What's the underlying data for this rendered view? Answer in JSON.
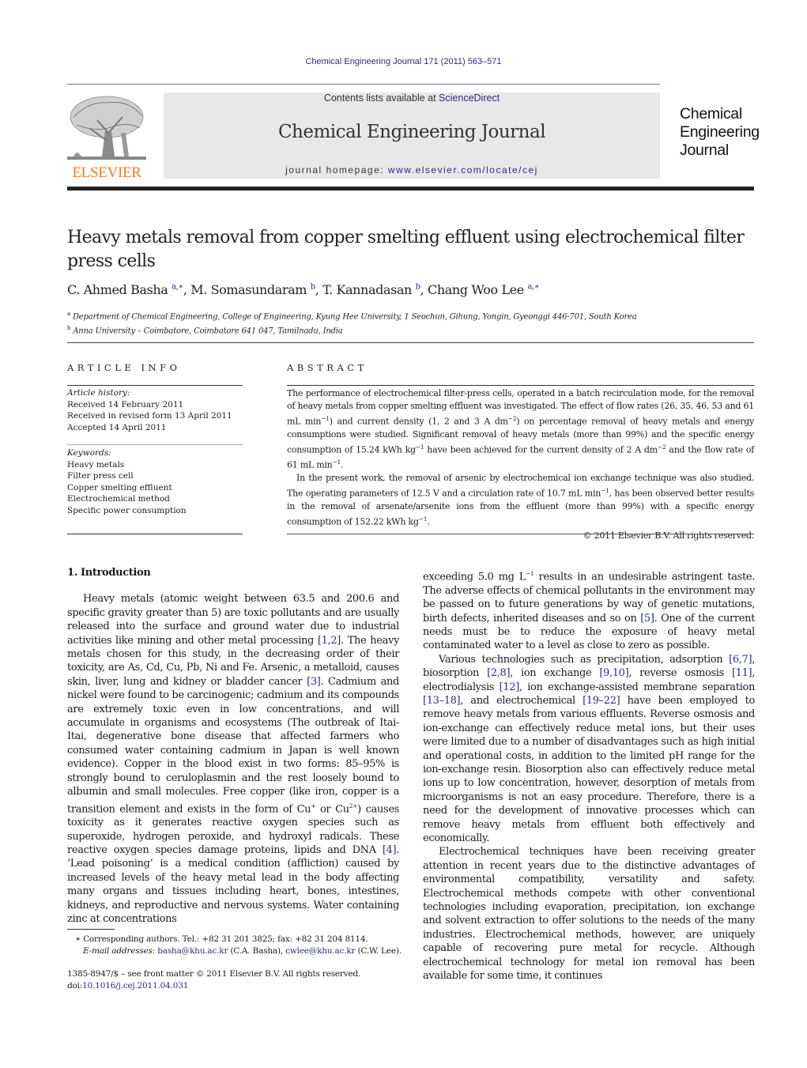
{
  "header": {
    "citation": "Chemical Engineering Journal 171 (2011) 563–571",
    "publisher_logo_word": "ELSEVIER",
    "contents_prefix": "Contents lists available at ",
    "contents_link": "ScienceDirect",
    "journal_title": "Chemical Engineering Journal",
    "homepage_prefix": "journal homepage: ",
    "homepage_link": "www.elsevier.com/locate/cej",
    "cover_title_lines": [
      "Chemical",
      "Engineering",
      "Journal"
    ],
    "colors": {
      "elsevier_orange": "#f07f1a",
      "link_blue": "#2a2a8c",
      "banner_gray": "#e8e8e8"
    }
  },
  "article": {
    "title": "Heavy metals removal from copper smelting effluent using electrochemical filter press cells",
    "authors": [
      {
        "name": "C. Ahmed Basha",
        "sup": "a,∗"
      },
      {
        "name": "M. Somasundaram",
        "sup": "b"
      },
      {
        "name": "T. Kannadasan",
        "sup": "b"
      },
      {
        "name": "Chang Woo Lee",
        "sup": "a,∗"
      }
    ],
    "affiliations": [
      {
        "mark": "a",
        "text": "Department of Chemical Engineering, College of Engineering, Kyung Hee University, 1 Seochun, Gihung, Yongin, Gyeonggi 446-701, South Korea"
      },
      {
        "mark": "b",
        "text": "Anna University – Coimbatore, Coimbatore 641 047, Tamilnadu, India"
      }
    ]
  },
  "article_info": {
    "heading": "ARTICLE INFO",
    "history_label": "Article history:",
    "history": [
      "Received 14 February 2011",
      "Received in revised form 13 April 2011",
      "Accepted 14 April 2011"
    ],
    "keywords_label": "Keywords:",
    "keywords": [
      "Heavy metals",
      "Filter press cell",
      "Copper smelting effluent",
      "Electrochemical method",
      "Specific power consumption"
    ]
  },
  "abstract": {
    "heading": "ABSTRACT",
    "p1": [
      "The performance of electrochemical filter-press cells, operated in a batch recirculation mode, for the removal of heavy metals from copper smelting effluent was investigated. The effect of flow rates (26, 35, 46, 53 and 61 mL min",
      "−1",
      ") and current density (1, 2 and 3 A dm",
      "−2",
      ") on percentage removal of heavy metals and energy consumptions were studied. Significant removal of heavy metals (more than 99%) and the specific energy consumption of 15.24 kWh kg",
      "−1",
      " have been achieved for the current density of 2 A dm",
      "−2",
      " and the flow rate of 61 mL min",
      "−1",
      "."
    ],
    "p2": [
      "In the present work, the removal of arsenic by electrochemical ion exchange technique was also studied. The operating parameters of 12.5 V and a circulation rate of 10.7 mL min",
      "−1",
      ", has been observed better results in the removal of arsenate/arsenite ions from the effluent (more than 99%) with a specific energy consumption of 152.22 kWh kg",
      "−1",
      "."
    ],
    "copyright": "© 2011 Elsevier B.V. All rights reserved."
  },
  "body": {
    "section_heading": "1.  Introduction",
    "left_p1": {
      "t1": "Heavy metals (atomic weight between 63.5 and 200.6 and specific gravity greater than 5) are toxic pollutants and are usually released into the surface and ground water due to industrial activities like mining and other metal processing ",
      "r1": "[1,2]",
      "t2": ". The heavy metals chosen for this study, in the decreasing order of their toxicity, are As, Cd, Cu, Pb, Ni and Fe. Arsenic, a metalloid, causes skin, liver, lung and kidney or bladder cancer ",
      "r2": "[3]",
      "t3": ". Cadmium and nickel were found to be carcinogenic; cadmium and its compounds are extremely toxic even in low concentrations, and will accumulate in organisms and ecosystems (The outbreak of Itai-Itai, degenerative bone disease that affected farmers who consumed water containing cadmium in Japan is well known evidence). Copper in the blood exist in two forms: 85–95% is strongly bound to ceruloplasmin and the rest loosely bound to albumin and small molecules. Free copper (like iron, copper is a transition element and exists in the form of Cu",
      "s1": "+",
      "t4": " or Cu",
      "s2": "2+",
      "t5": ") causes toxicity as it generates reactive oxygen species such as superoxide, hydrogen peroxide, and hydroxyl radicals. These reactive oxygen species damage proteins, lipids and DNA ",
      "r3": "[4]",
      "t6": ". ‘Lead poisoning’ is a medical condition (affliction) caused by increased levels of the heavy metal lead in the body affecting many organs and tissues including heart, bones, intestines, kidneys, and reproductive and nervous systems. Water containing zinc at concentrations"
    },
    "right_p1": {
      "t1": "exceeding 5.0 mg L",
      "s1": "−1",
      "t2": " results in an undesirable astringent taste. The adverse effects of chemical pollutants in the environment may be passed on to future generations by way of genetic mutations, birth defects, inherited diseases and so on ",
      "r1": "[5]",
      "t3": ". One of the current needs must be to reduce the exposure of heavy metal contaminated water to a level as close to zero as possible."
    },
    "right_p2": {
      "t1": "Various technologies such as precipitation, adsorption ",
      "r1": "[6,7]",
      "t2": ", biosorption ",
      "r2": "[2,8]",
      "t3": ", ion exchange ",
      "r3": "[9,10]",
      "t4": ", reverse osmosis ",
      "r4": "[11]",
      "t5": ", electrodialysis ",
      "r5": "[12]",
      "t6": ", ion exchange-assisted membrane separation ",
      "r6": "[13–18]",
      "t7": ", and electrochemical ",
      "r7": "[19–22]",
      "t8": " have been employed to remove heavy metals from various effluents. Reverse osmosis and ion-exchange can effectively reduce metal ions, but their uses were limited due to a number of disadvantages such as high initial and operational costs, in addition to the limited pH range for the ion-exchange resin. Biosorption also can effectively reduce metal ions up to low concentration, however, desorption of metals from microorganisms is not an easy procedure. Therefore, there is a need for the development of innovative processes which can remove heavy metals from effluent both effectively and economically."
    },
    "right_p3": "Electrochemical techniques have been receiving greater attention in recent years due to the distinctive advantages of environmental compatibility, versatility and safety. Electrochemical methods compete with other conventional technologies including evaporation, precipitation, ion exchange and solvent extraction to offer solutions to the needs of the many industries. Electrochemical methods, however, are uniquely capable of recovering pure metal for recycle. Although electrochemical technology for metal ion removal has been available for some time, it continues"
  },
  "footnotes": {
    "star": "∗",
    "corresponding": "Corresponding authors. Tel.: +82 31 201 3825; fax: +82 31 204 8114.",
    "email_label": "E-mail addresses:",
    "email1": "basha@khu.ac.kr",
    "email1_who": " (C.A. Basha), ",
    "email2": "cwlee@khu.ac.kr",
    "email2_who": " (C.W. Lee)."
  },
  "front_matter": {
    "issn_line": "1385-8947/$ – see front matter © 2011 Elsevier B.V. All rights reserved.",
    "doi_prefix": "doi:",
    "doi": "10.1016/j.cej.2011.04.031"
  }
}
